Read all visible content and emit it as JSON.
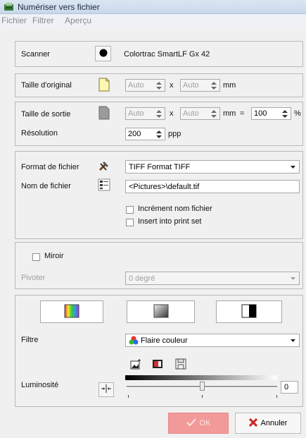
{
  "window": {
    "title": "Numériser vers fichier"
  },
  "menu": {
    "items": [
      "Fichier",
      "Filtrer",
      "Aperçu"
    ]
  },
  "scanner": {
    "label": "Scanner",
    "name": "Colortrac SmartLF Gx 42"
  },
  "original_size": {
    "label": "Taille d'original",
    "width": "Auto",
    "height": "Auto",
    "sep": "x",
    "unit": "mm"
  },
  "output_size": {
    "label": "Taille de sortie",
    "width": "Auto",
    "height": "Auto",
    "sep": "x",
    "unit": "mm",
    "equals": "=",
    "scale": "100",
    "scale_unit": "%"
  },
  "resolution": {
    "label": "Résolution",
    "value": "200",
    "unit": "ppp"
  },
  "file_format": {
    "label": "Format de fichier",
    "value": "TIFF Format TIFF"
  },
  "file_name": {
    "label": "Nom de fichier",
    "value": "<Pictures>\\default.tif"
  },
  "options": {
    "increment_label": "Incrément nom fichier",
    "insert_label": "Insert into print set"
  },
  "mirror": {
    "label": "Miroir"
  },
  "rotate": {
    "label": "Pivoter",
    "value": "0 degré"
  },
  "filter": {
    "label": "Filtre",
    "value": "Flaire couleur"
  },
  "brightness": {
    "label": "Luminosité",
    "value": "0",
    "level": 0.5
  },
  "buttons": {
    "ok": "OK",
    "cancel": "Annuler"
  },
  "colors": {
    "ok_bg": "#f29999",
    "cancel_icon": "#cc2222",
    "title_bg": "#dbe6f2"
  }
}
